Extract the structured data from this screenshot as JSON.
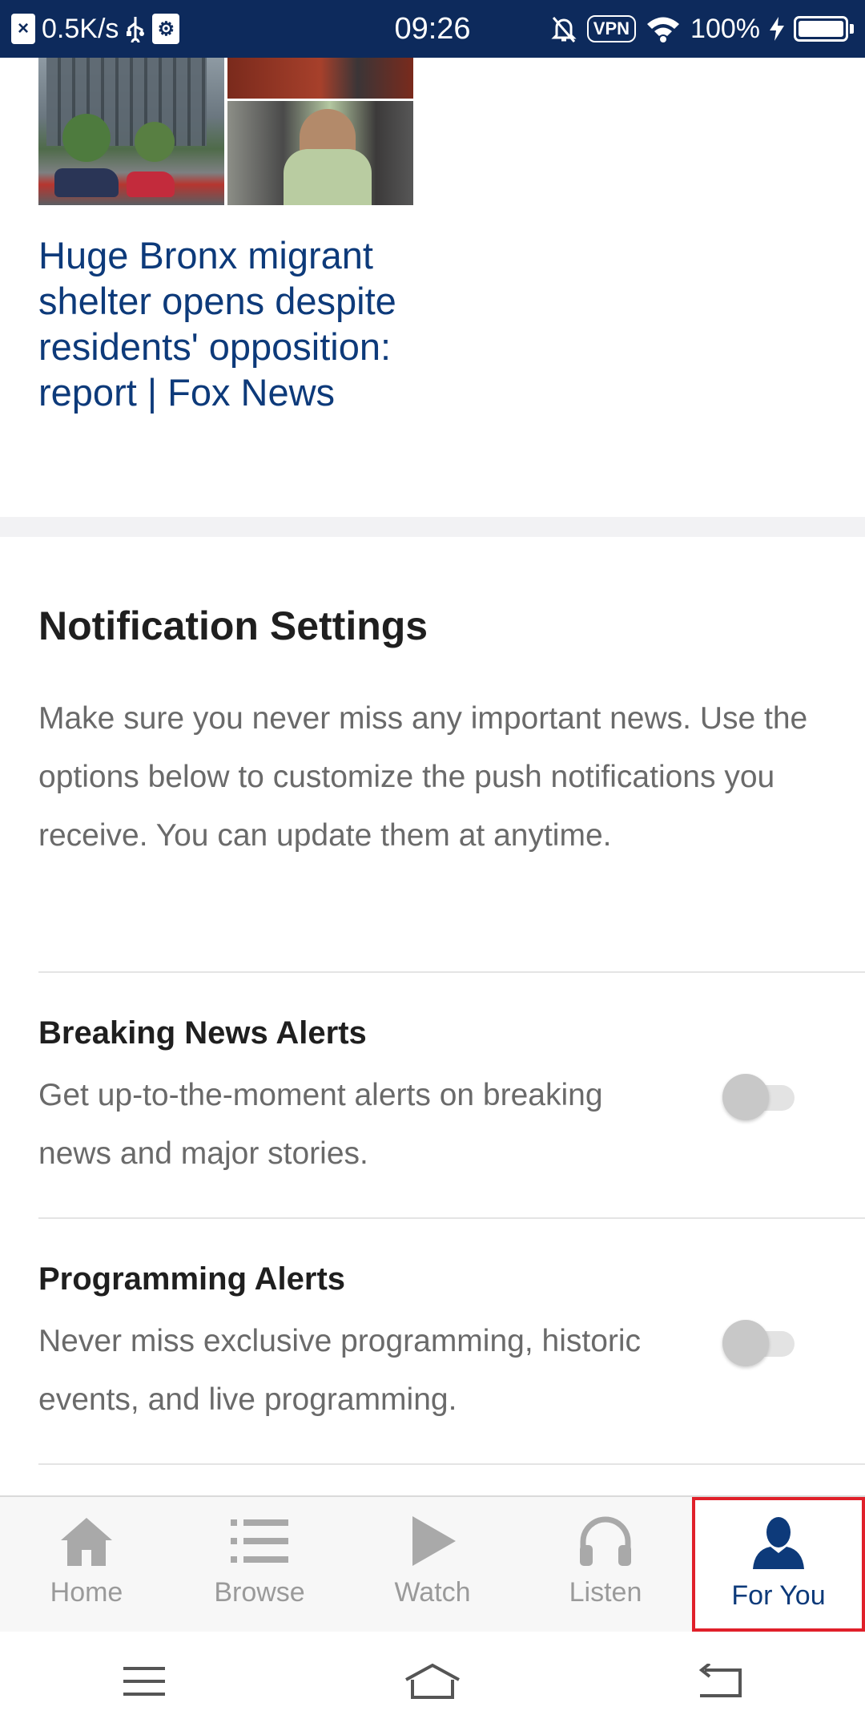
{
  "status_bar": {
    "speed": "0.5K/s",
    "time": "09:26",
    "vpn": "VPN",
    "battery": "100%"
  },
  "article": {
    "title": "Huge Bronx migrant shelter opens despite residents' opposition: report | Fox News"
  },
  "notifications": {
    "title": "Notification Settings",
    "description": "Make sure you never miss any important news. Use the options below to customize the push notifications you receive. You can update them at anytime.",
    "settings": [
      {
        "title": "Breaking News Alerts",
        "description": "Get up-to-the-moment alerts on breaking news and major stories.",
        "enabled": false
      },
      {
        "title": "Programming Alerts",
        "description": "Never miss exclusive programming, historic events, and live programming.",
        "enabled": false
      }
    ]
  },
  "tab_bar": {
    "tabs": [
      {
        "label": "Home",
        "icon": "home-icon"
      },
      {
        "label": "Browse",
        "icon": "list-icon"
      },
      {
        "label": "Watch",
        "icon": "play-icon"
      },
      {
        "label": "Listen",
        "icon": "headphones-icon"
      },
      {
        "label": "For You",
        "icon": "person-icon",
        "active": true
      }
    ]
  },
  "colors": {
    "status_bar_bg": "#0d2a5c",
    "headline_blue": "#0d3a7a",
    "active_tab": "#0d3a7a",
    "highlight_red": "#e0202a",
    "inactive_tab": "#9a9a9a"
  }
}
